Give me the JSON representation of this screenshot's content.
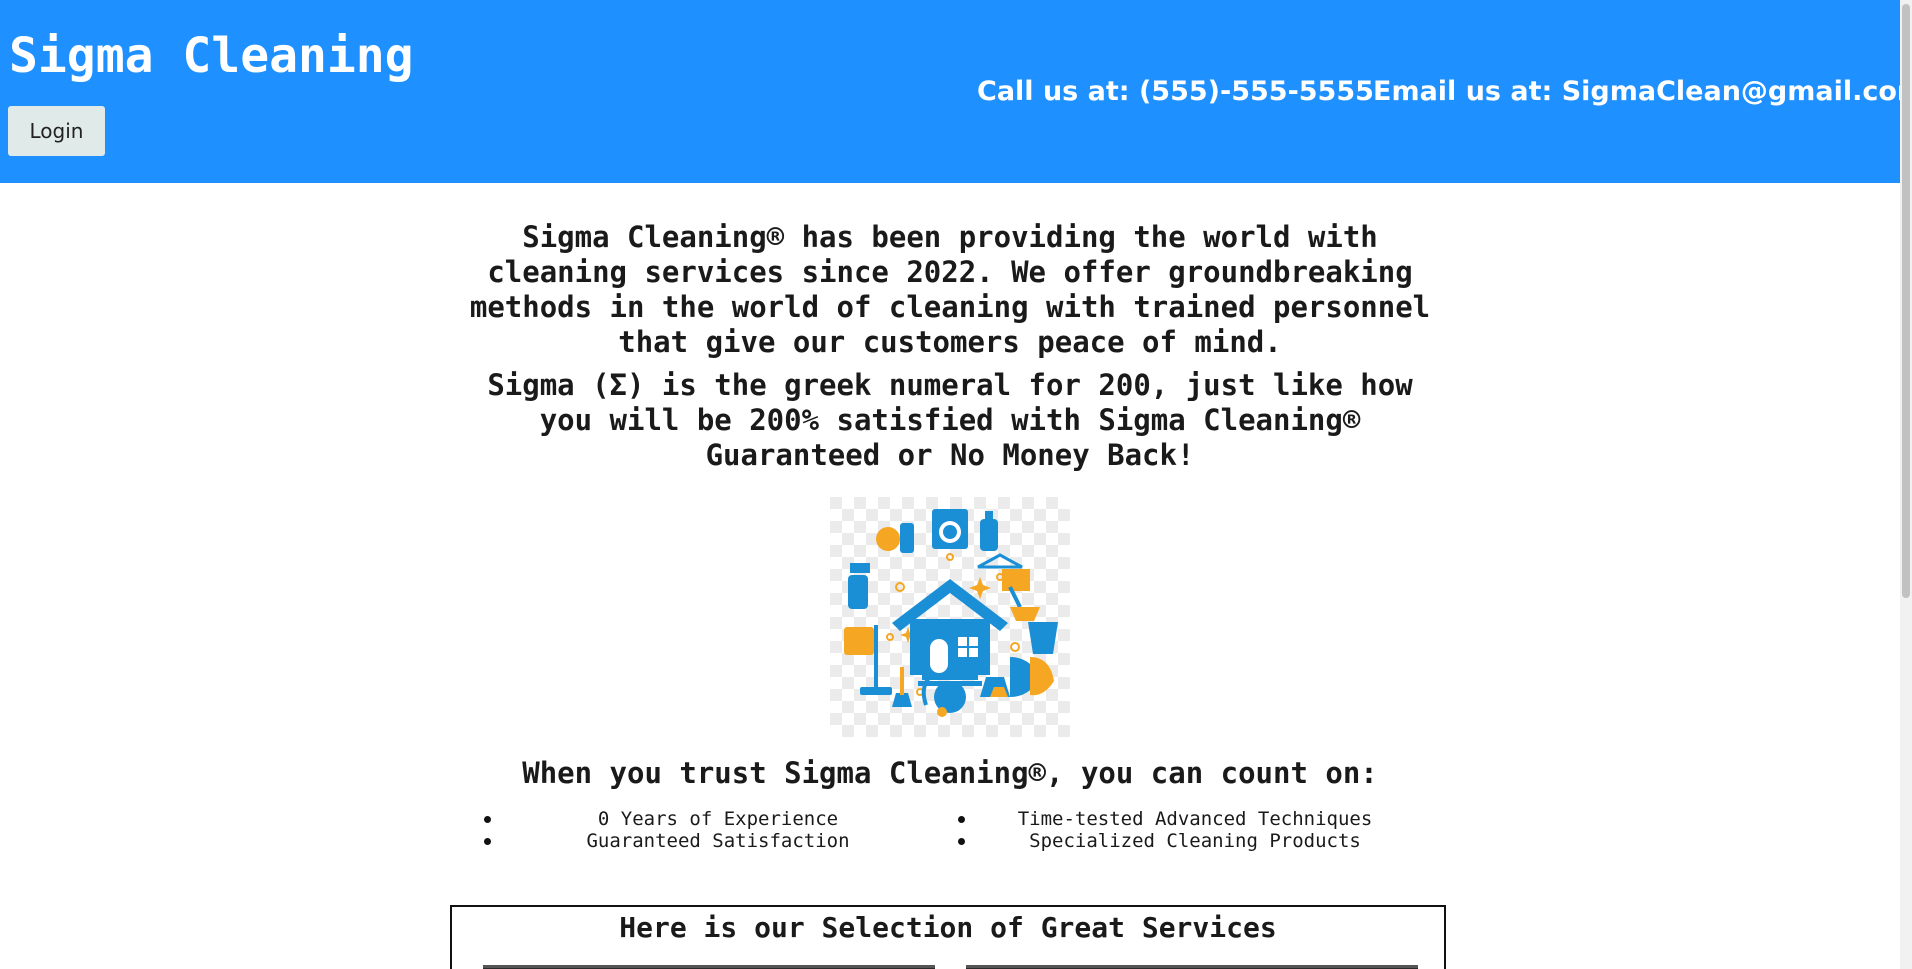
{
  "header": {
    "brand": "Sigma Cleaning",
    "login_label": "Login",
    "phone_text": "Call us at: (555)-555-5555",
    "email_text": "Email us at: SigmaClean@gmail.com"
  },
  "intro": {
    "paragraph1": "Sigma Cleaning® has been providing the world with cleaning services since 2022. We offer groundbreaking methods in the world of cleaning with trained personnel that give our customers peace of mind.",
    "paragraph2": "Sigma (Σ) is the greek numeral for 200, just like how you will be 200% satisfied with Sigma Cleaning® Guaranteed or No Money Back!"
  },
  "illustration": {
    "icon": "cleaning-house-collage-icon"
  },
  "trust": {
    "heading": "When you trust Sigma Cleaning®, you can count on:",
    "left_items": [
      "0 Years of Experience",
      "Guaranteed Satisfaction"
    ],
    "right_items": [
      "Time-tested Advanced Techniques",
      "Specialized Cleaning Products"
    ]
  },
  "services": {
    "title": "Here is our Selection of Great Services"
  },
  "colors": {
    "header_bg": "#1e90ff",
    "accent_orange": "#f5a623",
    "icon_blue": "#1b8fd6"
  }
}
